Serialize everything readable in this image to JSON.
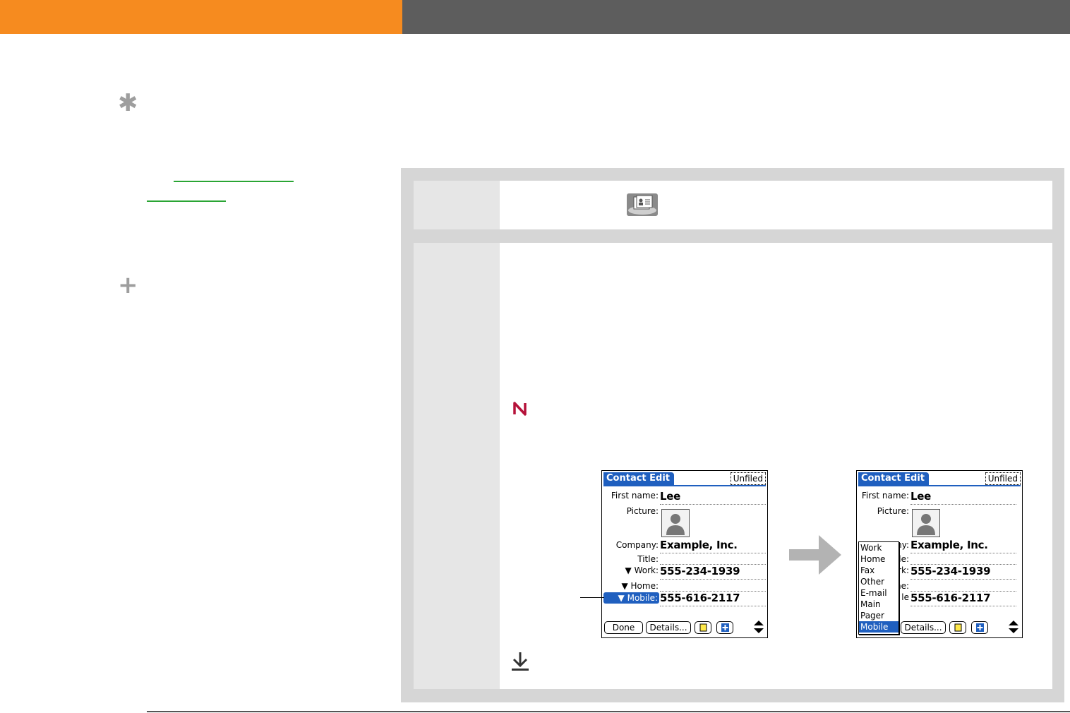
{
  "screens": [
    {
      "title": "Contact Edit",
      "category": "Unfiled",
      "fields": {
        "first_name_label": "First name:",
        "first_name_value": "Lee",
        "picture_label": "Picture:",
        "company_label": "Company:",
        "company_value": "Example, Inc.",
        "title_label": "Title:",
        "work_label": "Work:",
        "work_value": "555-234-1939",
        "home_label": "Home:",
        "mobile_label": "Mobile:",
        "mobile_value": "555-616-2117"
      },
      "buttons": {
        "done": "Done",
        "details": "Details..."
      }
    },
    {
      "title": "Contact Edit",
      "category": "Unfiled",
      "fields": {
        "first_name_label": "First name:",
        "first_name_value": "Lee",
        "picture_label": "Picture:",
        "company_label_partial": "ny:",
        "company_value": "Example, Inc.",
        "title_label_partial": "le:",
        "work_label_partial": "rk:",
        "work_value": "555-234-1939",
        "home_label_partial": "ne:",
        "mobile_label_partial": "le",
        "mobile_value": "555-616-2117"
      },
      "popup": [
        "Work",
        "Home",
        "Fax",
        "Other",
        "E-mail",
        "Main",
        "Pager",
        "Mobile"
      ],
      "popup_selected": "Mobile",
      "buttons": {
        "details": "Details..."
      }
    }
  ],
  "colors": {
    "orange_bar": "#f68b1f",
    "gray_bar": "#5d5d5d",
    "palm_blue": "#1f5fbf",
    "link_green": "#2aa534",
    "note_red": "#b5123a"
  },
  "icons": [
    "tip-asterisk-icon",
    "plus-icon",
    "contacts-app-icon",
    "note-icon",
    "arrow-right-icon",
    "download-arrow-icon"
  ]
}
